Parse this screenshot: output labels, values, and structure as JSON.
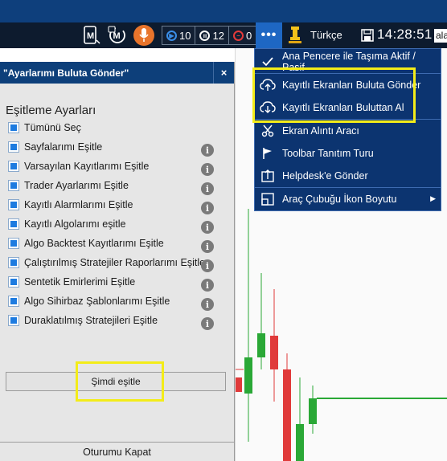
{
  "toolbar": {
    "counters": [
      {
        "label": "10",
        "icon": "play-circle-icon"
      },
      {
        "label": "12",
        "icon": "pause-circle-icon"
      },
      {
        "label": "0",
        "icon": "stop-circle-icon"
      }
    ],
    "more_label": "•••",
    "language": "Türkçe",
    "clock": "14:28:51",
    "search_value": "ala"
  },
  "panel": {
    "title": "\"Ayarlarımı Buluta Gönder\"",
    "close_label": "×",
    "section_title": "Eşitleme Ayarları",
    "options": [
      {
        "label": "Tümünü Seç",
        "checked": true,
        "info": false
      },
      {
        "label": "Sayfalarımı Eşitle",
        "checked": true,
        "info": true
      },
      {
        "label": "Varsayılan Kayıtlarımı Eşitle",
        "checked": true,
        "info": true
      },
      {
        "label": "Trader Ayarlarımı Eşitle",
        "checked": true,
        "info": true
      },
      {
        "label": "Kayıtlı Alarmlarımı Eşitle",
        "checked": true,
        "info": true
      },
      {
        "label": "Kayıtlı Algolarımı eşitle",
        "checked": true,
        "info": true
      },
      {
        "label": "Algo Backtest Kayıtlarımı Eşitle",
        "checked": true,
        "info": true
      },
      {
        "label": "Çalıştırılmış Stratejiler Raporlarımı Eşitle",
        "checked": true,
        "info": true
      },
      {
        "label": "Sentetik Emirlerimi Eşitle",
        "checked": true,
        "info": true
      },
      {
        "label": "Algo Sihirbaz Şablonlarımı Eşitle",
        "checked": true,
        "info": true
      },
      {
        "label": "Duraklatılmış Stratejileri Eşitle",
        "checked": true,
        "info": true
      }
    ],
    "info_glyph": "i",
    "sync_button": "Şimdi eşitle",
    "logout_button": "Oturumu Kapat"
  },
  "menu": {
    "items": [
      {
        "label": "Ana Pencere ile Taşıma Aktif / Pasif",
        "icon": "checkmark-icon"
      },
      {
        "label": "Kayıtlı Ekranları Buluta Gönder",
        "icon": "cloud-upload-icon"
      },
      {
        "label": "Kayıtlı Ekranları Buluttan Al",
        "icon": "cloud-download-icon"
      },
      {
        "label": "Ekran Alıntı Aracı",
        "icon": "scissors-icon"
      },
      {
        "label": "Toolbar Tanıtım Turu",
        "icon": "flag-icon"
      },
      {
        "label": "Helpdesk'e Gönder",
        "icon": "send-box-icon"
      },
      {
        "label": "Araç Çubuğu İkon Boyutu",
        "icon": "resize-icon",
        "submenu": true
      }
    ]
  },
  "colors": {
    "toolbar_bg": "#0d1b2e",
    "menu_bg": "#0c3470",
    "panel_header": "#0d3f7a",
    "highlight": "#f3ec19",
    "candle_up": "#2aa836",
    "candle_down": "#e03a3a"
  }
}
